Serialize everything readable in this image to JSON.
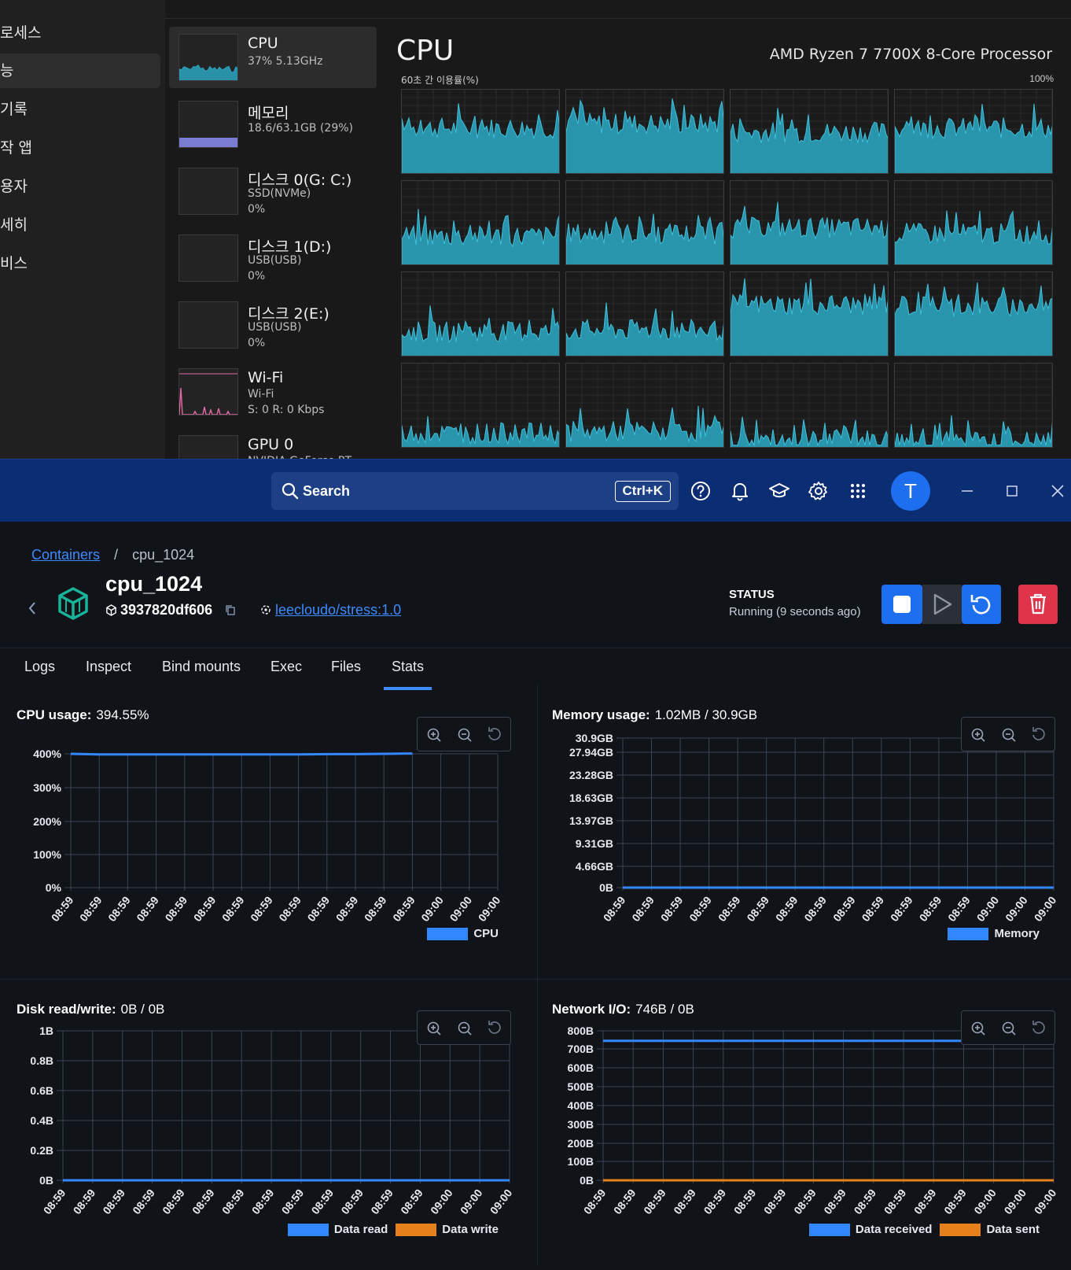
{
  "taskmanager": {
    "nav_items": [
      "로세스",
      "능",
      "기록",
      "작 앱",
      "용자",
      "세히",
      "비스"
    ],
    "active_nav_index": 1,
    "devices": [
      {
        "name": "CPU",
        "sub1": "37%  5.13GHz",
        "sub2": ""
      },
      {
        "name": "메모리",
        "sub1": "18.6/63.1GB (29%)",
        "sub2": ""
      },
      {
        "name": "디스크 0(G: C:)",
        "sub1": "SSD(NVMe)",
        "sub2": "0%"
      },
      {
        "name": "디스크 1(D:)",
        "sub1": "USB(USB)",
        "sub2": "0%"
      },
      {
        "name": "디스크 2(E:)",
        "sub1": "USB(USB)",
        "sub2": "0%"
      },
      {
        "name": "Wi-Fi",
        "sub1": "Wi-Fi",
        "sub2": "S: 0 R: 0 Kbps"
      },
      {
        "name": "GPU 0",
        "sub1": "NVIDIA GeForce RT...",
        "sub2": ""
      }
    ],
    "main": {
      "title": "CPU",
      "processor": "AMD Ryzen 7 7700X 8-Core Processor",
      "axis_left": "60초 간 이용률(%)",
      "axis_right": "100%",
      "core_levels": [
        0.55,
        0.6,
        0.5,
        0.55,
        0.35,
        0.38,
        0.45,
        0.38,
        0.3,
        0.32,
        0.62,
        0.6,
        0.18,
        0.2,
        0.1,
        0.08
      ]
    },
    "colors": {
      "cpu": "#2aa6c1",
      "memory": "#7a7cd4",
      "disk": "#4caf7a",
      "wifi": "#e06aa6"
    }
  },
  "appbar": {
    "search_label": "Search",
    "search_shortcut": "Ctrl+K",
    "icons": [
      "help-icon",
      "bell-icon",
      "graduation-cap-icon",
      "gear-icon",
      "apps-grid-icon"
    ],
    "avatar_letter": "T"
  },
  "breadcrumb": {
    "parent": "Containers",
    "current": "cpu_1024"
  },
  "container": {
    "name": "cpu_1024",
    "id": "3937820df606",
    "image": "leecloudo/stress:1.0",
    "status_label": "STATUS",
    "status_value": "Running (9 seconds ago)"
  },
  "tabs": [
    "Logs",
    "Inspect",
    "Bind mounts",
    "Exec",
    "Files",
    "Stats"
  ],
  "active_tab": "Stats",
  "colors": {
    "accent": "#3d8bff",
    "primary_button": "#1e6ff0",
    "danger": "#e0344a",
    "series_blue": "#3388ff",
    "series_orange": "#e5801a"
  },
  "chart_data": [
    {
      "type": "line",
      "title": "CPU usage:",
      "title_value": "394.55%",
      "x": [
        "08:59",
        "08:59",
        "08:59",
        "08:59",
        "08:59",
        "08:59",
        "08:59",
        "08:59",
        "08:59",
        "08:59",
        "08:59",
        "08:59",
        "08:59",
        "09:00",
        "09:00",
        "09:00"
      ],
      "yticks": [
        "400%",
        "300%",
        "200%",
        "100%",
        "0%"
      ],
      "ylim": [
        0,
        400
      ],
      "series": [
        {
          "name": "CPU",
          "values": [
            400,
            398,
            398,
            398,
            398,
            398,
            398,
            398,
            398,
            399,
            399,
            400,
            401,
            null,
            null,
            null
          ]
        }
      ]
    },
    {
      "type": "line",
      "title": "Memory usage:",
      "title_value": "1.02MB / 30.9GB",
      "x": [
        "08:59",
        "08:59",
        "08:59",
        "08:59",
        "08:59",
        "08:59",
        "08:59",
        "08:59",
        "08:59",
        "08:59",
        "08:59",
        "08:59",
        "08:59",
        "09:00",
        "09:00",
        "09:00"
      ],
      "yticks": [
        "30.9GB",
        "27.94GB",
        "23.28GB",
        "18.63GB",
        "13.97GB",
        "9.31GB",
        "4.66GB",
        "0B"
      ],
      "ylim": [
        0,
        30.9
      ],
      "series": [
        {
          "name": "Memory",
          "values": [
            0.001,
            0.001,
            0.001,
            0.001,
            0.001,
            0.001,
            0.001,
            0.001,
            0.001,
            0.001,
            0.001,
            0.001,
            0.001,
            0.001,
            0.001,
            0.001
          ]
        }
      ]
    },
    {
      "type": "line",
      "title": "Disk read/write:",
      "title_value": "0B / 0B",
      "x": [
        "08:59",
        "08:59",
        "08:59",
        "08:59",
        "08:59",
        "08:59",
        "08:59",
        "08:59",
        "08:59",
        "08:59",
        "08:59",
        "08:59",
        "08:59",
        "09:00",
        "09:00",
        "09:00"
      ],
      "yticks": [
        "1B",
        "0.8B",
        "0.6B",
        "0.4B",
        "0.2B",
        "0B"
      ],
      "ylim": [
        0,
        1
      ],
      "series": [
        {
          "name": "Data read",
          "values": [
            0,
            0,
            0,
            0,
            0,
            0,
            0,
            0,
            0,
            0,
            0,
            0,
            0,
            0,
            0,
            0
          ]
        },
        {
          "name": "Data write",
          "values": [
            0,
            0,
            0,
            0,
            0,
            0,
            0,
            0,
            0,
            0,
            0,
            0,
            0,
            0,
            0,
            0
          ]
        }
      ]
    },
    {
      "type": "line",
      "title": "Network I/O:",
      "title_value": "746B / 0B",
      "x": [
        "08:59",
        "08:59",
        "08:59",
        "08:59",
        "08:59",
        "08:59",
        "08:59",
        "08:59",
        "08:59",
        "08:59",
        "08:59",
        "08:59",
        "08:59",
        "09:00",
        "09:00",
        "09:00"
      ],
      "yticks": [
        "800B",
        "700B",
        "600B",
        "500B",
        "400B",
        "300B",
        "200B",
        "100B",
        "0B"
      ],
      "ylim": [
        0,
        800
      ],
      "series": [
        {
          "name": "Data received",
          "values": [
            746,
            746,
            746,
            746,
            746,
            746,
            746,
            746,
            746,
            746,
            746,
            746,
            746,
            746,
            null,
            null
          ]
        },
        {
          "name": "Data sent",
          "values": [
            0,
            0,
            0,
            0,
            0,
            0,
            0,
            0,
            0,
            0,
            0,
            0,
            0,
            0,
            0,
            0
          ]
        }
      ]
    }
  ]
}
